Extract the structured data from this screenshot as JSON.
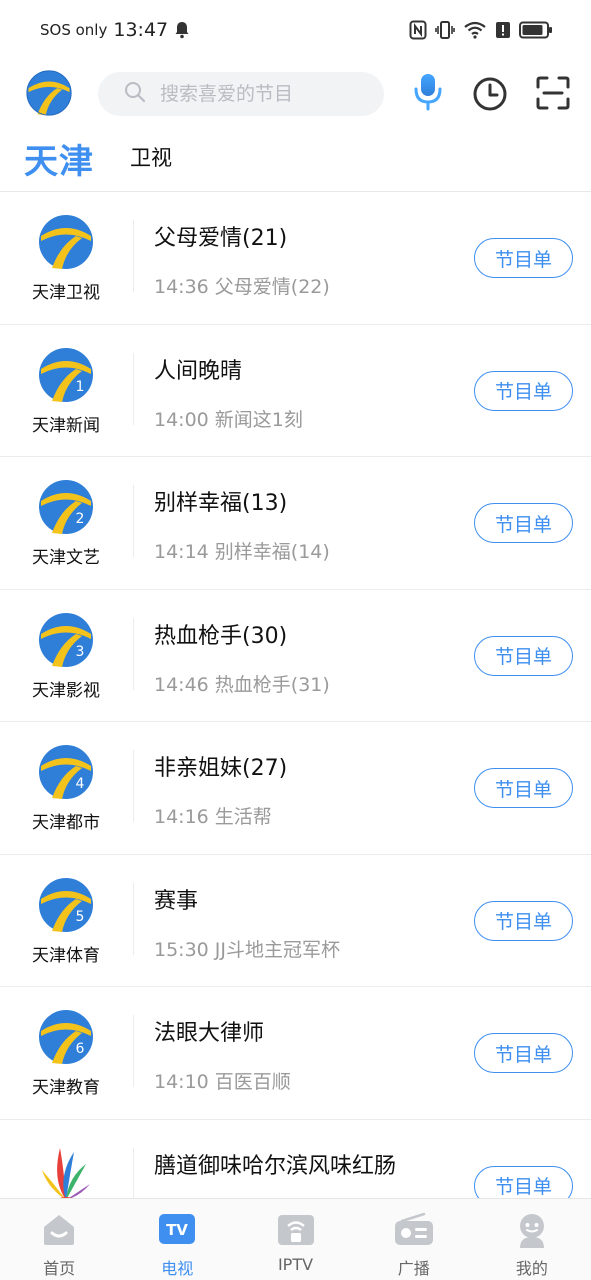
{
  "status_bar": {
    "carrier": "SOS only",
    "time": "13:47"
  },
  "header": {
    "search_placeholder": "搜索喜爱的节目",
    "icons": [
      "tianjin-logo-icon",
      "search-icon",
      "microphone-icon",
      "history-clock-icon",
      "scan-icon"
    ]
  },
  "tabs": [
    {
      "label": "天津",
      "active": true
    },
    {
      "label": "卫视",
      "active": false
    }
  ],
  "channels": [
    {
      "name": "天津卫视",
      "badge": "",
      "now": "父母爱情(21)",
      "next": "14:36 父母爱情(22)",
      "button": "节目单"
    },
    {
      "name": "天津新闻",
      "badge": "1",
      "now": "人间晚晴",
      "next": "14:00 新闻这1刻",
      "button": "节目单"
    },
    {
      "name": "天津文艺",
      "badge": "2",
      "now": "别样幸福(13)",
      "next": "14:14 别样幸福(14)",
      "button": "节目单"
    },
    {
      "name": "天津影视",
      "badge": "3",
      "now": "热血枪手(30)",
      "next": "14:46 热血枪手(31)",
      "button": "节目单"
    },
    {
      "name": "天津都市",
      "badge": "4",
      "now": "非亲姐妹(27)",
      "next": "14:16 生活帮",
      "button": "节目单"
    },
    {
      "name": "天津体育",
      "badge": "5",
      "now": "赛事",
      "next": "15:30 JJ斗地主冠军杯",
      "button": "节目单"
    },
    {
      "name": "天津教育",
      "badge": "6",
      "now": "法眼大律师",
      "next": "14:10 百医百顺",
      "button": "节目单"
    },
    {
      "name": "",
      "badge": "",
      "now": "膳道御味哈尔滨风味红肠",
      "next": "",
      "button": "节目单"
    }
  ],
  "bottom_nav": [
    {
      "label": "首页",
      "icon": "home-icon",
      "active": false
    },
    {
      "label": "电视",
      "icon": "tv-icon",
      "active": true
    },
    {
      "label": "IPTV",
      "icon": "iptv-icon",
      "active": false
    },
    {
      "label": "广播",
      "icon": "radio-icon",
      "active": false
    },
    {
      "label": "我的",
      "icon": "profile-icon",
      "active": false
    }
  ],
  "colors": {
    "accent": "#3e8ff0",
    "logo_blue": "#2f7fd9",
    "logo_yellow": "#f4c31b",
    "text_secondary": "#9a9a9a"
  }
}
